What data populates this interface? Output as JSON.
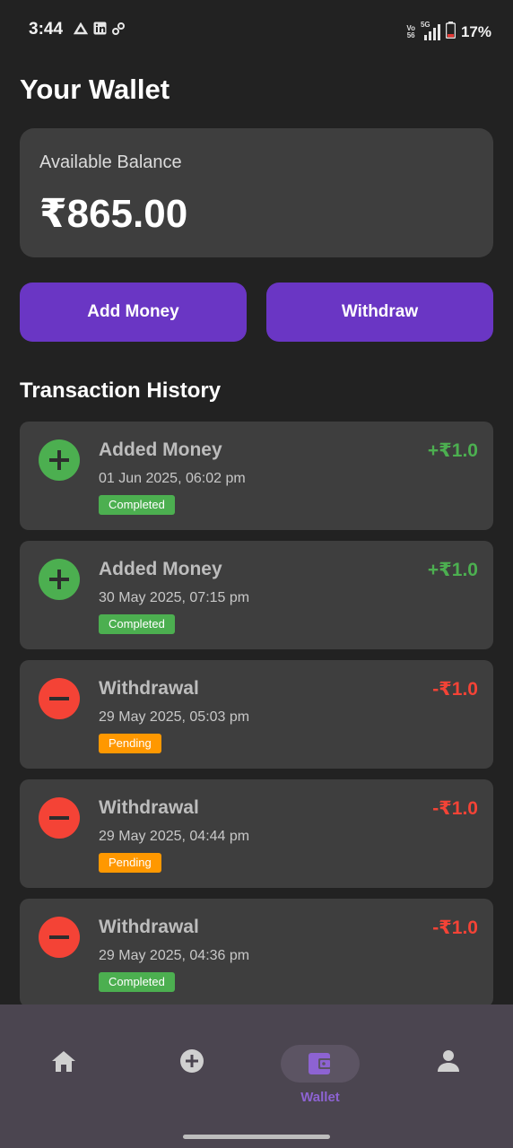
{
  "status_bar": {
    "time": "3:44",
    "network_top": "Vo",
    "network_bottom": "56",
    "network_type": "5G",
    "battery_percent": "17%"
  },
  "page": {
    "title": "Your Wallet"
  },
  "balance": {
    "label": "Available Balance",
    "amount": "₹865.00"
  },
  "actions": {
    "add_money": "Add Money",
    "withdraw": "Withdraw"
  },
  "history": {
    "title": "Transaction History",
    "transactions": [
      {
        "type": "credit",
        "title": "Added Money",
        "date": "01 Jun 2025, 06:02 pm",
        "status": "Completed",
        "amount": "+₹1.0"
      },
      {
        "type": "credit",
        "title": "Added Money",
        "date": "30 May 2025, 07:15 pm",
        "status": "Completed",
        "amount": "+₹1.0"
      },
      {
        "type": "debit",
        "title": "Withdrawal",
        "date": "29 May 2025, 05:03 pm",
        "status": "Pending",
        "amount": "-₹1.0"
      },
      {
        "type": "debit",
        "title": "Withdrawal",
        "date": "29 May 2025, 04:44 pm",
        "status": "Pending",
        "amount": "-₹1.0"
      },
      {
        "type": "debit",
        "title": "Withdrawal",
        "date": "29 May 2025, 04:36 pm",
        "status": "Completed",
        "amount": "-₹1.0"
      }
    ]
  },
  "bottom_nav": {
    "items": [
      {
        "icon": "home-icon",
        "label": ""
      },
      {
        "icon": "add-circle-icon",
        "label": ""
      },
      {
        "icon": "wallet-icon",
        "label": "Wallet",
        "active": true
      },
      {
        "icon": "person-icon",
        "label": ""
      }
    ]
  },
  "colors": {
    "background": "#222222",
    "card": "#3e3e3e",
    "accent": "#6a36c4",
    "credit": "#4caf50",
    "debit": "#f44336",
    "completed_badge": "#4caf50",
    "pending_badge": "#ff9800",
    "nav_active": "#8d63d2"
  }
}
